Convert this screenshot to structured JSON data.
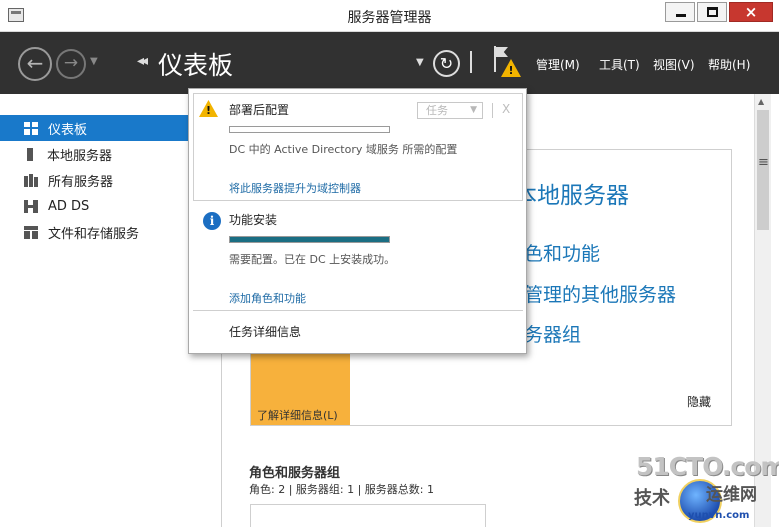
{
  "window": {
    "title": "服务器管理器",
    "close_glyph": "×"
  },
  "header": {
    "breadcrumb_arrow": "◂◂",
    "page_title": "仪表板",
    "menus": [
      "管理(M)",
      "工具(T)",
      "视图(V)",
      "帮助(H)"
    ]
  },
  "sidebar": {
    "items": [
      {
        "label": "仪表板",
        "icon": "dashboard-icon",
        "active": true
      },
      {
        "label": "本地服务器",
        "icon": "server-icon"
      },
      {
        "label": "所有服务器",
        "icon": "servers-icon"
      },
      {
        "label": "AD DS",
        "icon": "ad-ds-icon"
      },
      {
        "label": "文件和存储服务",
        "icon": "file-storage-icon"
      }
    ]
  },
  "main": {
    "welcome_lines": [
      "本地服务器",
      "色和功能",
      "管理的其他服务器",
      "务器组"
    ],
    "learn_more": "了解详细信息(L)",
    "hide": "隐藏",
    "roles_title": "角色和服务器组",
    "roles_summary": "角色: 2 | 服务器组: 1 | 服务器总数: 1"
  },
  "notifications": {
    "deploy": {
      "title": "部署后配置",
      "task_button": "任务",
      "close": "X",
      "progress": 0,
      "desc": "DC 中的 Active Directory 域服务 所需的配置",
      "link": "将此服务器提升为域控制器"
    },
    "feature": {
      "title": "功能安装",
      "progress": 1,
      "desc": "需要配置。已在 DC 上安装成功。",
      "link": "添加角色和功能"
    },
    "details": "任务详细信息"
  },
  "watermark": {
    "brand": "51CTO.com",
    "line_a": "技术",
    "line_b": "运维网",
    "url": "yunvn.com"
  },
  "colors": {
    "accent": "#1979ca",
    "header": "#313131",
    "warning": "#f2b400",
    "progress": "#1b6e83",
    "link": "#1d6aa5"
  }
}
